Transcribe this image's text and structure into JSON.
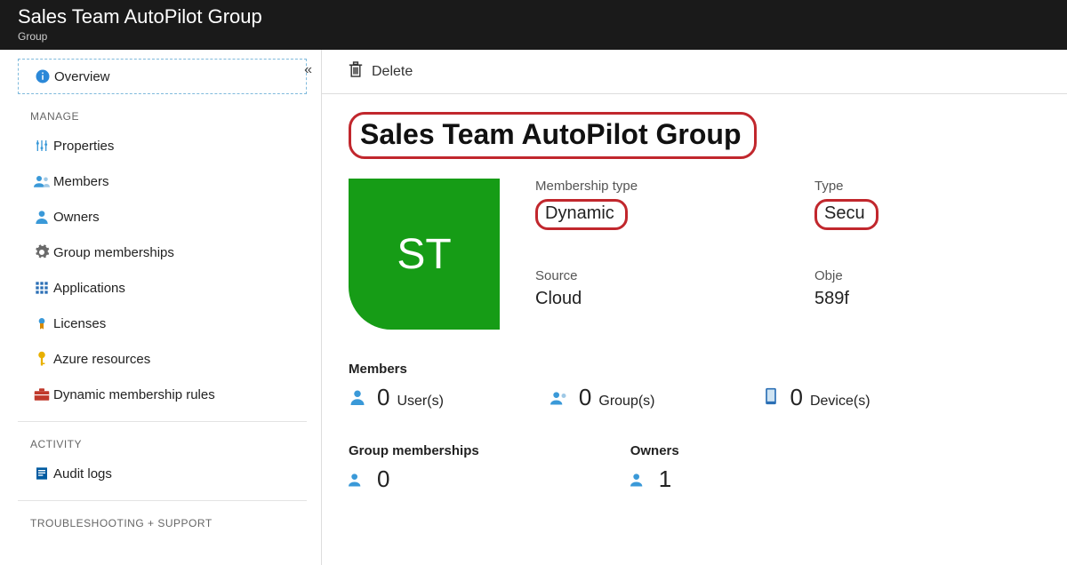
{
  "header": {
    "title": "Sales Team AutoPilot Group",
    "subtitle": "Group"
  },
  "sidebar": {
    "collapse_glyph": "«",
    "items": [
      {
        "label": "Overview"
      },
      {
        "label": "Properties"
      },
      {
        "label": "Members"
      },
      {
        "label": "Owners"
      },
      {
        "label": "Group memberships"
      },
      {
        "label": "Applications"
      },
      {
        "label": "Licenses"
      },
      {
        "label": "Azure resources"
      },
      {
        "label": "Dynamic membership rules"
      },
      {
        "label": "Audit logs"
      }
    ],
    "section_manage": "MANAGE",
    "section_activity": "ACTIVITY",
    "section_troubleshoot": "TROUBLESHOOTING + SUPPORT"
  },
  "toolbar": {
    "delete_label": "Delete"
  },
  "page": {
    "title": "Sales Team AutoPilot Group",
    "tile_initials": "ST",
    "props": {
      "membership_type_label": "Membership type",
      "membership_type_value": "Dynamic",
      "type_label": "Type",
      "type_value": "Secu",
      "source_label": "Source",
      "source_value": "Cloud",
      "objectid_label": "Obje",
      "objectid_value": "589f"
    },
    "members_heading": "Members",
    "members_stats": {
      "users": "0",
      "users_unit": "User(s)",
      "groups": "0",
      "groups_unit": "Group(s)",
      "devices": "0",
      "devices_unit": "Device(s)"
    },
    "group_memberships_heading": "Group memberships",
    "group_memberships_value": "0",
    "owners_heading": "Owners",
    "owners_value": "1"
  }
}
